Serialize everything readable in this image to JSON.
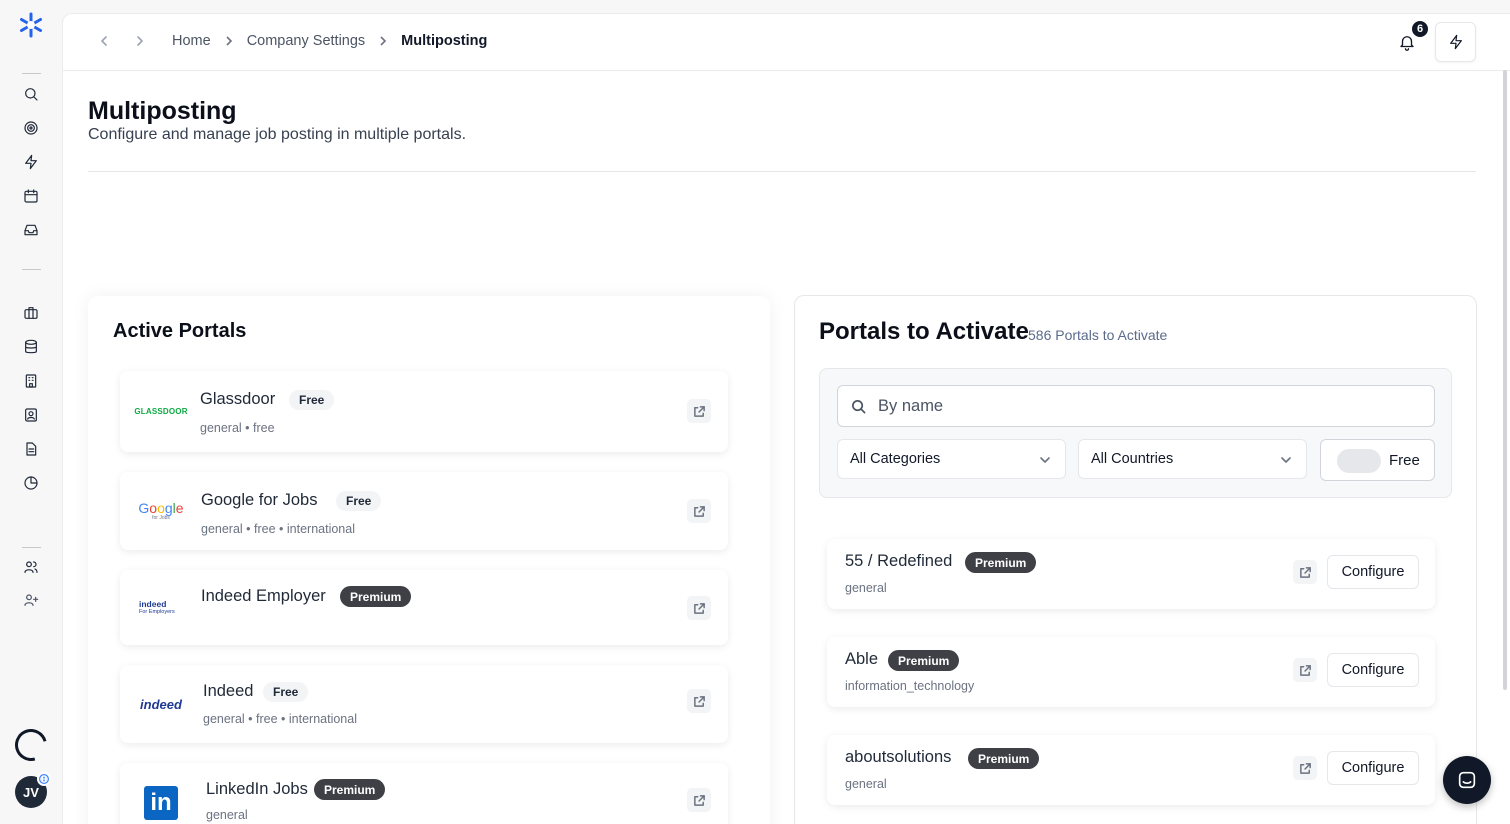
{
  "breadcrumb": {
    "items": [
      "Home",
      "Company Settings",
      "Multiposting"
    ]
  },
  "notifications": {
    "count": "6"
  },
  "header": {
    "title": "Multiposting",
    "subtitle": "Configure and manage job posting in multiple portals."
  },
  "active_portals": {
    "title": "Active Portals",
    "items": [
      {
        "name": "Glassdoor",
        "badge": "Free",
        "meta": "general • free",
        "logo": "glassdoor-logo",
        "logo_text": "GLASSDOOR"
      },
      {
        "name": "Google for Jobs",
        "badge": "Free",
        "meta": "general • free • international",
        "logo": "google-for-jobs-logo",
        "logo_text": "Google",
        "logo_sub": "for Jobs"
      },
      {
        "name": "Indeed Employer",
        "badge": "Premium",
        "meta": "",
        "logo": "indeed-employer-logo",
        "logo_text": "indeed",
        "logo_sub": "For Employers"
      },
      {
        "name": "Indeed",
        "badge": "Free",
        "meta": "general • free • international",
        "logo": "indeed-logo",
        "logo_text": "indeed"
      },
      {
        "name": "LinkedIn Jobs",
        "badge": "Premium",
        "meta": "general",
        "logo": "linkedin-logo",
        "logo_text": "in"
      }
    ]
  },
  "portals_to_activate": {
    "title": "Portals to Activate",
    "count_label": "586 Portals to Activate",
    "search_placeholder": "By name",
    "category_select": "All Categories",
    "country_select": "All Countries",
    "free_toggle_label": "Free",
    "configure_label": "Configure",
    "items": [
      {
        "name": "55 / Redefined",
        "badge": "Premium",
        "meta": "general"
      },
      {
        "name": "Able",
        "badge": "Premium",
        "meta": "information_technology"
      },
      {
        "name": "aboutsolutions",
        "badge": "Premium",
        "meta": "general"
      }
    ]
  },
  "user": {
    "initials": "JV"
  },
  "colors": {
    "premium_badge": "#3f3f46",
    "free_badge": "#f3f4f6",
    "accent_blue": "#3b82f6",
    "linkedin_blue": "#0a66c2",
    "glassdoor_green": "#0caa41"
  }
}
